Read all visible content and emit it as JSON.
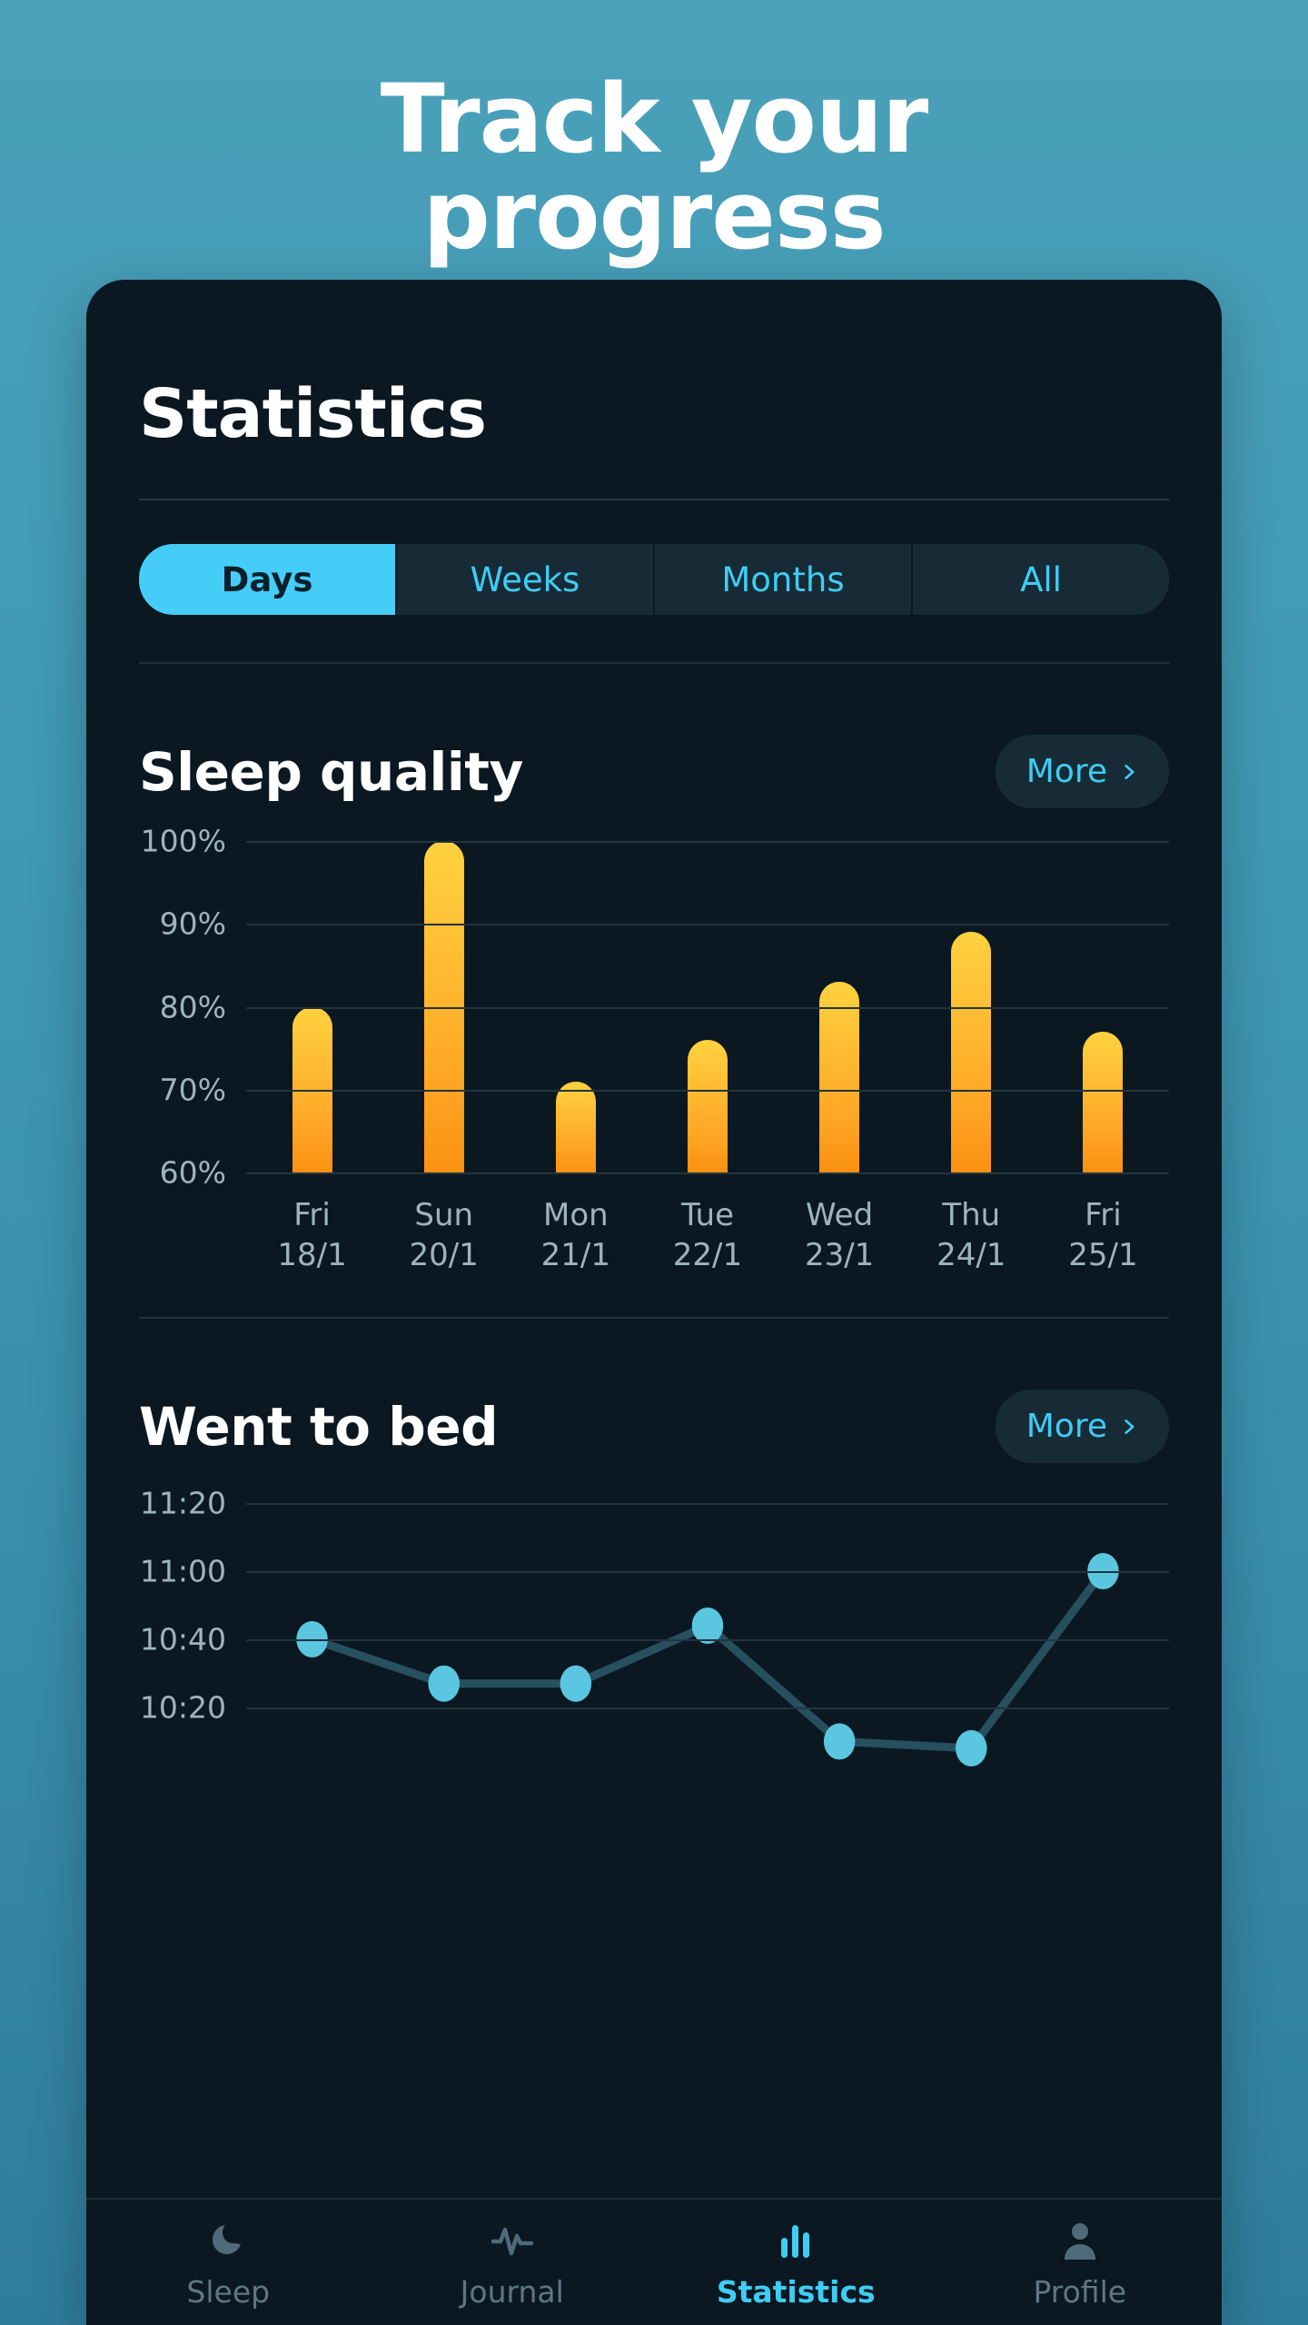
{
  "hero": {
    "title": "Track your progress"
  },
  "card": {
    "page_title": "Statistics",
    "tabs": [
      {
        "label": "Days",
        "active": true
      },
      {
        "label": "Weeks",
        "active": false
      },
      {
        "label": "Months",
        "active": false
      },
      {
        "label": "All",
        "active": false
      }
    ],
    "sections": [
      {
        "title": "Sleep quality",
        "more_label": "More",
        "more_icon": "chevron-right-icon"
      },
      {
        "title": "Went to bed",
        "more_label": "More",
        "more_icon": "chevron-right-icon"
      }
    ]
  },
  "bottom_nav": [
    {
      "label": "Sleep",
      "icon": "moon-icon",
      "active": false
    },
    {
      "label": "Journal",
      "icon": "pulse-icon",
      "active": false
    },
    {
      "label": "Statistics",
      "icon": "bar-chart-icon",
      "active": true
    },
    {
      "label": "Profile",
      "icon": "person-icon",
      "active": false
    }
  ],
  "colors": {
    "accent_cyan": "#3ecdf5",
    "accent_cyan_active": "#45cdf7",
    "bar_top": "#ffd23f",
    "bar_bottom": "#fb9111",
    "line_dot": "#5bc6e0",
    "line_stroke": "#27505f",
    "card_bg": "#0b1821",
    "background_top": "#4aa0b9",
    "background_bottom": "#2f7c9b"
  },
  "chart_data": [
    {
      "type": "bar",
      "title": "Sleep quality",
      "categories": [
        "Fri\n18/1",
        "Sun\n20/1",
        "Mon\n21/1",
        "Tue\n22/1",
        "Wed\n23/1",
        "Thu\n24/1",
        "Fri\n25/1"
      ],
      "day_labels": [
        "Fri",
        "Sun",
        "Mon",
        "Tue",
        "Wed",
        "Thu",
        "Fri"
      ],
      "date_labels": [
        "18/1",
        "20/1",
        "21/1",
        "22/1",
        "23/1",
        "24/1",
        "25/1"
      ],
      "values": [
        80,
        100,
        71,
        76,
        83,
        89,
        77
      ],
      "ytick_labels": [
        "100%",
        "90%",
        "80%",
        "70%",
        "60%"
      ],
      "yticks": [
        100,
        90,
        80,
        70,
        60
      ],
      "ylim": [
        60,
        100
      ],
      "xlabel": "",
      "ylabel": "",
      "grid": true,
      "legend": "none"
    },
    {
      "type": "line",
      "title": "Went to bed",
      "categories": [
        "Fri 18/1",
        "Sun 20/1",
        "Mon 21/1",
        "Tue 22/1",
        "Wed 23/1",
        "Thu 24/1",
        "Fri 25/1"
      ],
      "values": [
        "10:40",
        "10:27",
        "10:27",
        "10:44",
        "10:10",
        "10:08",
        "11:00"
      ],
      "values_minutes": [
        640,
        627,
        627,
        644,
        610,
        608,
        660
      ],
      "ytick_labels": [
        "11:20",
        "11:00",
        "10:40",
        "10:20"
      ],
      "yticks_minutes": [
        680,
        660,
        640,
        620
      ],
      "ylim_minutes": [
        600,
        680
      ],
      "xlabel": "",
      "ylabel": "",
      "grid": true,
      "legend": "none",
      "markers": true
    }
  ]
}
